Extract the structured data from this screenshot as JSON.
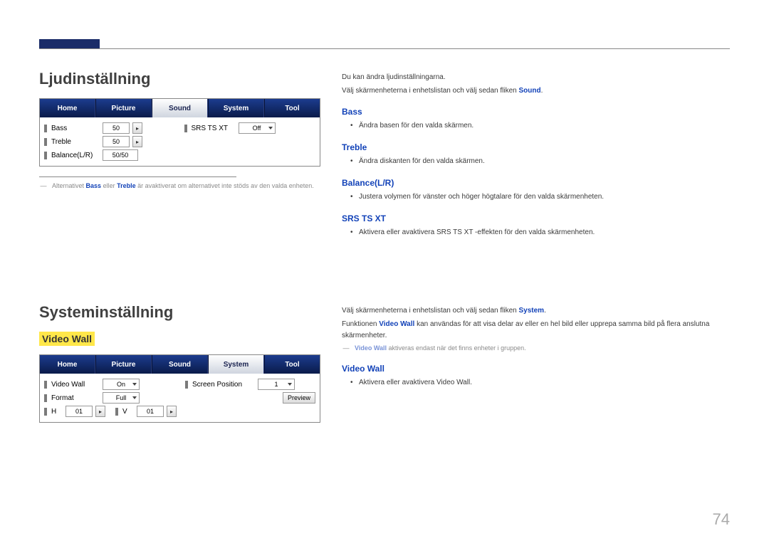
{
  "pageNumber": "74",
  "section1": {
    "title": "Ljudinställning",
    "tabs": [
      "Home",
      "Picture",
      "Sound",
      "System",
      "Tool"
    ],
    "activeTab": "Sound",
    "left": {
      "bass_label": "Bass",
      "bass_value": "50",
      "treble_label": "Treble",
      "treble_value": "50",
      "balance_label": "Balance(L/R)",
      "balance_value": "50/50"
    },
    "right": {
      "srs_label": "SRS TS XT",
      "srs_value": "Off"
    },
    "footnote_pre": "Alternativet ",
    "footnote_b1": "Bass",
    "footnote_mid": " eller ",
    "footnote_b2": "Treble",
    "footnote_post": " är avaktiverat om alternativet inte stöds av den valda enheten."
  },
  "section1_right": {
    "intro1": "Du kan ändra ljudinställningarna.",
    "intro2_pre": "Välj skärmenheterna i enhetslistan och välj sedan fliken ",
    "intro2_hl": "Sound",
    "bass_h": "Bass",
    "bass_li": "Ändra basen för den valda skärmen.",
    "treble_h": "Treble",
    "treble_li": "Ändra diskanten för den valda skärmen.",
    "balance_h": "Balance(L/R)",
    "balance_li": "Justera volymen för vänster och höger högtalare för den valda skärmenheten.",
    "srs_h": "SRS TS XT",
    "srs_li_pre": "Aktivera eller avaktivera ",
    "srs_li_hl": "SRS TS XT",
    "srs_li_post": "-effekten för den valda skärmenheten."
  },
  "section2": {
    "title": "Systeminställning",
    "sub": "Video Wall",
    "tabs": [
      "Home",
      "Picture",
      "Sound",
      "System",
      "Tool"
    ],
    "activeTab": "System",
    "left": {
      "vw_label": "Video Wall",
      "vw_value": "On",
      "fmt_label": "Format",
      "fmt_value": "Full",
      "h_label": "H",
      "h_value": "01",
      "v_label": "V",
      "v_value": "01"
    },
    "right": {
      "sp_label": "Screen Position",
      "sp_value": "1",
      "preview": "Preview"
    }
  },
  "section2_right": {
    "intro_pre": "Välj skärmenheterna i enhetslistan och välj sedan fliken ",
    "intro_hl": "System",
    "p2_pre": "Funktionen ",
    "p2_hl": "Video Wall",
    "p2_post": " kan användas för att visa delar av eller en hel bild eller upprepa samma bild på flera anslutna skärmenheter.",
    "note_hl": "Video Wall",
    "note_post": " aktiveras endast när det finns enheter i gruppen.",
    "vw_h": "Video Wall",
    "vw_li_pre": "Aktivera eller avaktivera ",
    "vw_li_hl": "Video Wall"
  }
}
